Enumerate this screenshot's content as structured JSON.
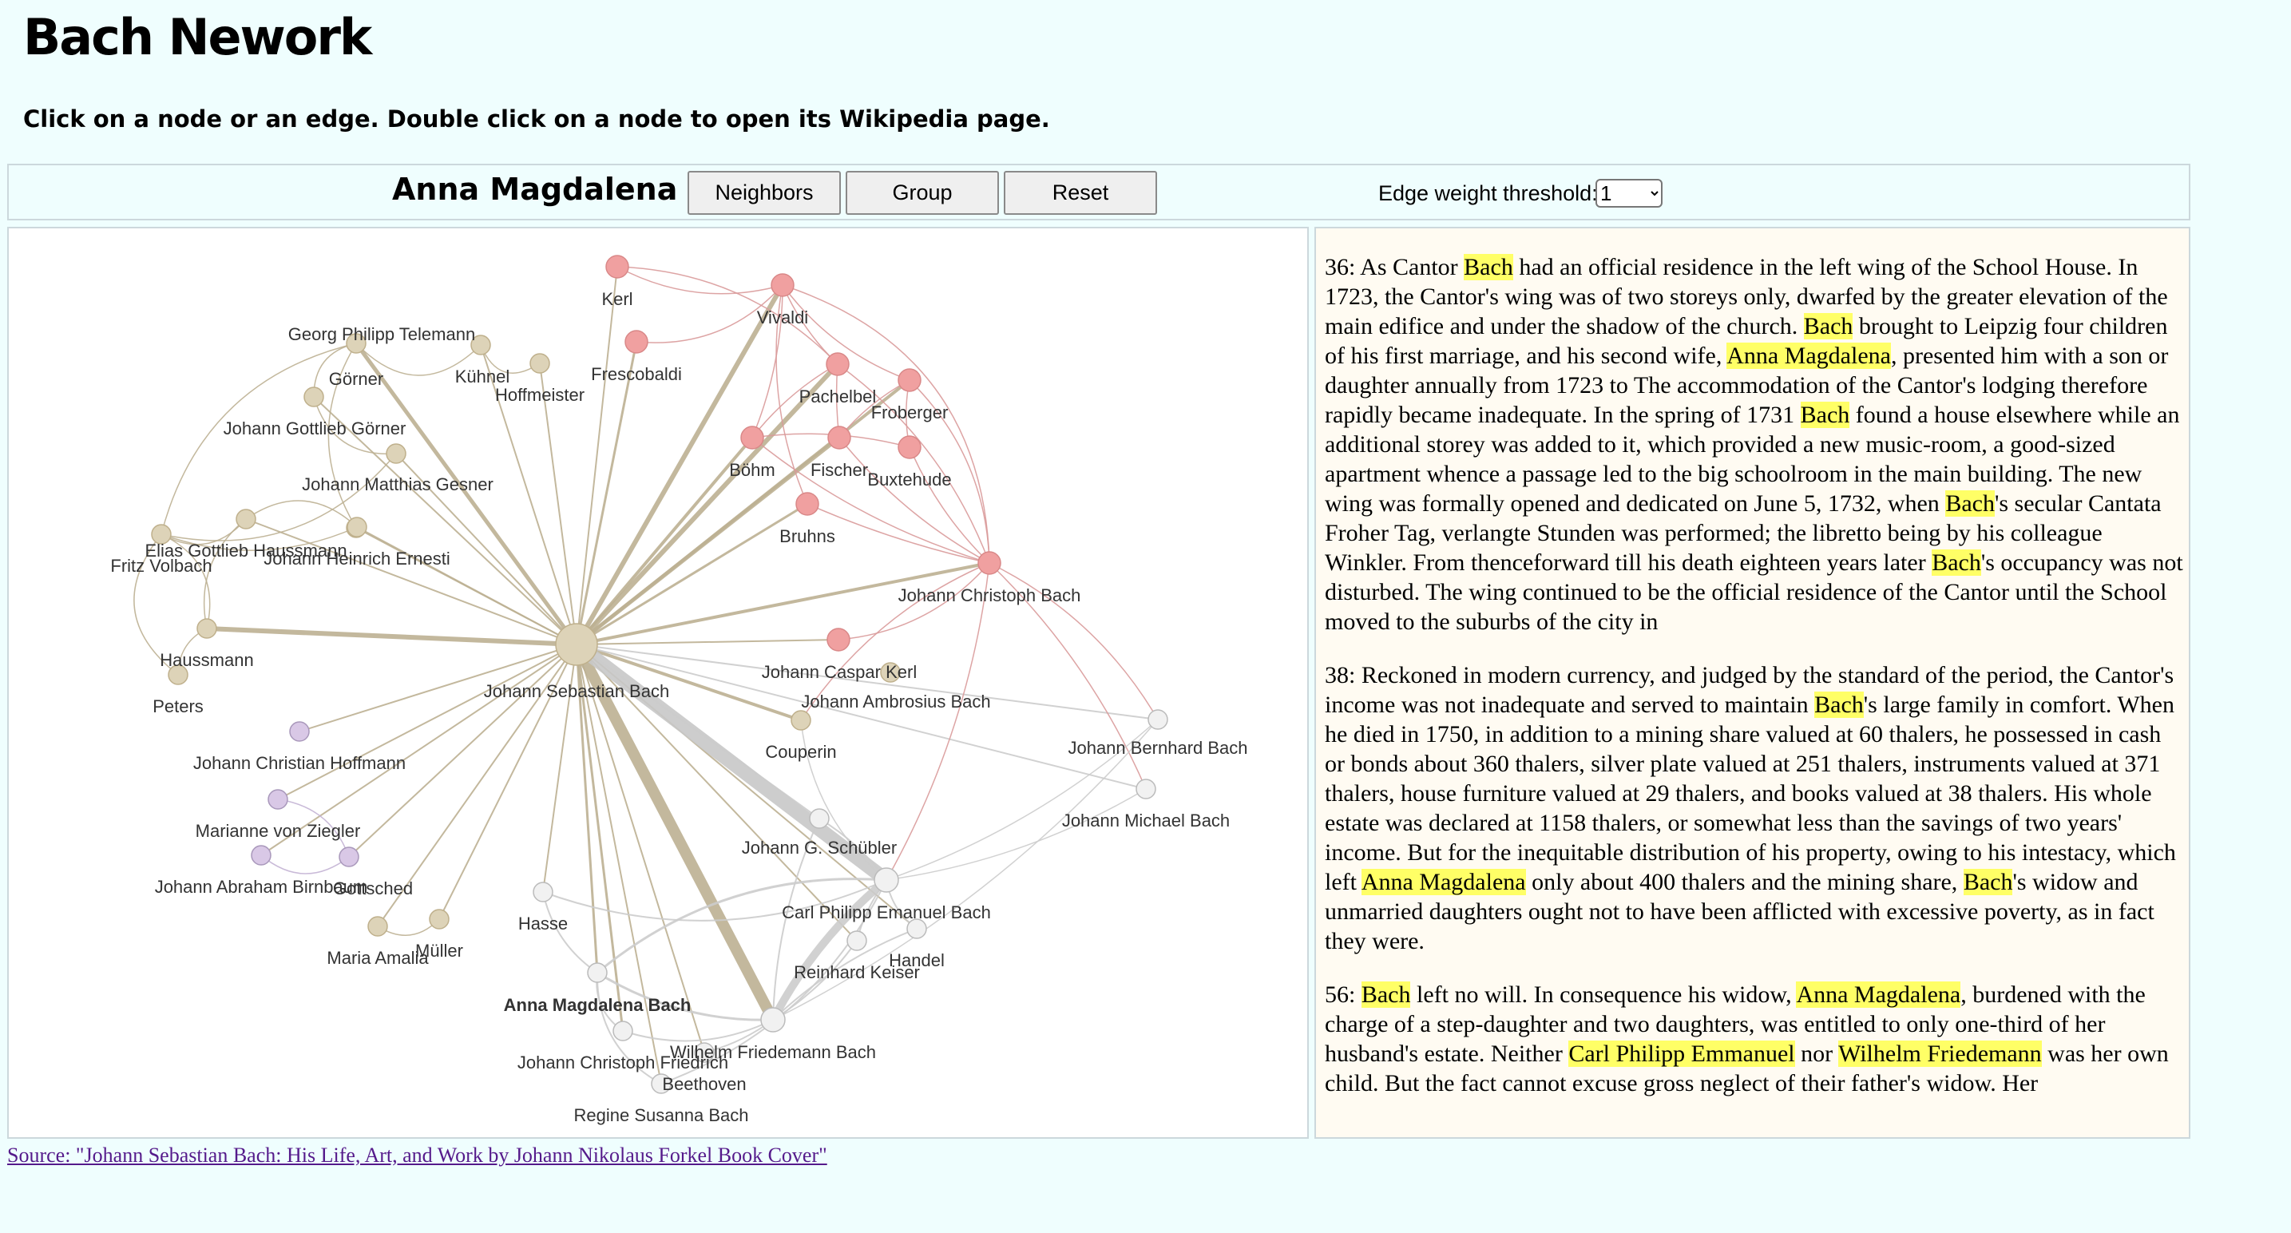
{
  "header": {
    "title": "Bach Nework",
    "subtitle": "Click on a node or an edge. Double click on a node to open its Wikipedia page."
  },
  "toolbar": {
    "selected_name": "Anna Magdalena Bach",
    "neighbors_label": "Neighbors",
    "group_label": "Group",
    "reset_label": "Reset",
    "threshold_label": "Edge weight threshold:",
    "threshold_value": "1",
    "threshold_options": [
      "1"
    ]
  },
  "colors": {
    "page_background": "#effefe",
    "highlight": "#ffff66",
    "group_beige": "#ddd3b8",
    "group_red": "#f0a0a0",
    "group_purple": "#d9c8e6",
    "group_white": "#f1f1f1",
    "edge_beige": "#bcb092",
    "edge_red": "#d99a9a",
    "edge_grey": "#cccccc"
  },
  "graph": {
    "selected_node": "Anna Magdalena Bach",
    "nodes": [
      {
        "id": "Johann Sebastian Bach",
        "group": "beige"
      },
      {
        "id": "Georg Philipp Telemann",
        "group": "beige"
      },
      {
        "id": "Görner",
        "group": "beige"
      },
      {
        "id": "Kühnel",
        "group": "beige"
      },
      {
        "id": "Hoffmeister",
        "group": "beige"
      },
      {
        "id": "Johann Gottlieb Görner",
        "group": "beige"
      },
      {
        "id": "Johann Matthias Gesner",
        "group": "beige"
      },
      {
        "id": "Elias Gottlieb Haussmann",
        "group": "beige"
      },
      {
        "id": "Johann Heinrich Ernesti",
        "group": "beige"
      },
      {
        "id": "Fritz Volbach",
        "group": "beige"
      },
      {
        "id": "Haussmann",
        "group": "beige"
      },
      {
        "id": "Peters",
        "group": "beige"
      },
      {
        "id": "Couperin",
        "group": "beige"
      },
      {
        "id": "Maria Amalia",
        "group": "beige"
      },
      {
        "id": "Müller",
        "group": "beige"
      },
      {
        "id": "Johann Caspar Kerl",
        "group": "beige"
      },
      {
        "id": "Kerl",
        "group": "red"
      },
      {
        "id": "Vivaldi",
        "group": "red"
      },
      {
        "id": "Frescobaldi",
        "group": "red"
      },
      {
        "id": "Pachelbel",
        "group": "red"
      },
      {
        "id": "Froberger",
        "group": "red"
      },
      {
        "id": "Böhm",
        "group": "red"
      },
      {
        "id": "Fischer",
        "group": "red"
      },
      {
        "id": "Buxtehude",
        "group": "red"
      },
      {
        "id": "Bruhns",
        "group": "red"
      },
      {
        "id": "Johann Christoph Bach",
        "group": "red"
      },
      {
        "id": "Johann Ambrosius Bach",
        "group": "red"
      },
      {
        "id": "Johann Christian Hoffmann",
        "group": "purple"
      },
      {
        "id": "Marianne von Ziegler",
        "group": "purple"
      },
      {
        "id": "Johann Abraham Birnbaum",
        "group": "purple"
      },
      {
        "id": "Gottsched",
        "group": "purple"
      },
      {
        "id": "Johann Bernhard Bach",
        "group": "white"
      },
      {
        "id": "Johann Michael Bach",
        "group": "white"
      },
      {
        "id": "Johann G. Schübler",
        "group": "white"
      },
      {
        "id": "Carl Philipp Emanuel Bach",
        "group": "white"
      },
      {
        "id": "Handel",
        "group": "white"
      },
      {
        "id": "Reinhard Keiser",
        "group": "white"
      },
      {
        "id": "Hasse",
        "group": "white"
      },
      {
        "id": "Anna Magdalena Bach",
        "group": "white"
      },
      {
        "id": "Johann Christoph Friedrich",
        "group": "white"
      },
      {
        "id": "Wilhelm Friedemann Bach",
        "group": "white"
      },
      {
        "id": "Beethoven",
        "group": "white"
      },
      {
        "id": "Regine Susanna Bach",
        "group": "white"
      }
    ]
  },
  "passages": [
    {
      "segments": [
        {
          "t": "36: As Cantor "
        },
        {
          "t": "Bach",
          "hl": true
        },
        {
          "t": " had an official residence in the left wing of the School House. In 1723, the Cantor's wing was of two storeys only, dwarfed by the greater elevation of the main edifice and under the shadow of the church. "
        },
        {
          "t": "Bach",
          "hl": true
        },
        {
          "t": " brought to Leipzig four children of his first marriage, and his second wife, "
        },
        {
          "t": "Anna Magdalena",
          "hl": true
        },
        {
          "t": ", presented him with a son or daughter annually from 1723 to The accommodation of the Cantor's lodging therefore rapidly became inadequate. In the spring of 1731 "
        },
        {
          "t": "Bach",
          "hl": true
        },
        {
          "t": " found a house elsewhere while an additional storey was added to it, which provided a new music-room, a good-sized apartment whence a passage led to the big schoolroom in the main building. The new wing was formally opened and dedicated on June 5, 1732, when "
        },
        {
          "t": "Bach",
          "hl": true
        },
        {
          "t": "'s secular Cantata Froher Tag, verlangte Stunden was performed; the libretto being by his colleague Winkler. From thenceforward till his death eighteen years later "
        },
        {
          "t": "Bach",
          "hl": true
        },
        {
          "t": "'s occupancy was not disturbed. The wing continued to be the official residence of the Cantor until the School moved to the suburbs of the city in"
        }
      ]
    },
    {
      "segments": [
        {
          "t": "38: Reckoned in modern currency, and judged by the standard of the period, the Cantor's income was not inadequate and served to maintain "
        },
        {
          "t": "Bach",
          "hl": true
        },
        {
          "t": "'s large family in comfort. When he died in 1750, in addition to a mining share valued at 60 thalers, he possessed in cash or bonds about 360 thalers, silver plate valued at 251 thalers, instruments valued at 371 thalers, house furniture valued at 29 thalers, and books valued at 38 thalers. His whole estate was declared at 1158 thalers, or somewhat less than the savings of two years' income. But for the inequitable distribution of his property, owing to his intestacy, which left "
        },
        {
          "t": "Anna Magdalena",
          "hl": true
        },
        {
          "t": " only about 400 thalers and the mining share, "
        },
        {
          "t": "Bach",
          "hl": true
        },
        {
          "t": "'s widow and unmarried daughters ought not to have been afflicted with excessive poverty, as in fact they were."
        }
      ]
    },
    {
      "segments": [
        {
          "t": "56: "
        },
        {
          "t": "Bach",
          "hl": true
        },
        {
          "t": " left no will. In consequence his widow, "
        },
        {
          "t": "Anna Magdalena",
          "hl": true
        },
        {
          "t": ", burdened with the charge of a step-daughter and two daughters, was entitled to only one-third of her husband's estate. Neither "
        },
        {
          "t": "Carl Philipp Emmanuel",
          "hl": true
        },
        {
          "t": " nor "
        },
        {
          "t": "Wilhelm Friedemann",
          "hl": true
        },
        {
          "t": " was her own child. But the fact cannot excuse gross neglect of their father's widow. Her"
        }
      ]
    }
  ],
  "footer": {
    "source_link": "Source: \"Johann Sebastian Bach: His Life, Art, and Work by Johann Nikolaus Forkel Book Cover\""
  }
}
